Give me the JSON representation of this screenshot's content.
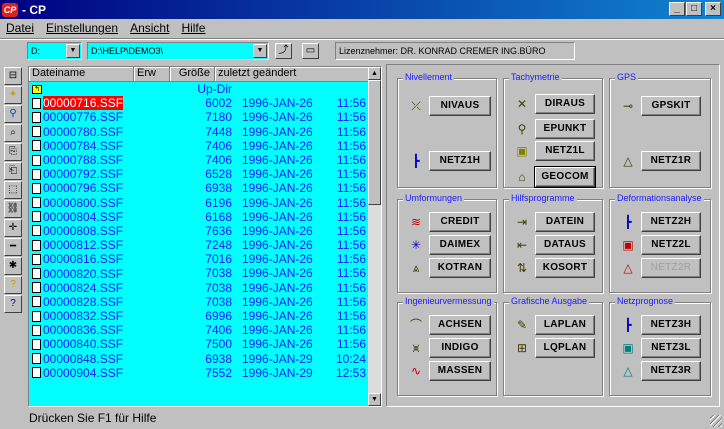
{
  "window": {
    "title": "- CP",
    "app_icon": "CP",
    "minimize": "_",
    "maximize": "□",
    "close": "×"
  },
  "menu": [
    "Datei",
    "Einstellungen",
    "Ansicht",
    "Hilfe"
  ],
  "toolbar": {
    "drive": "D:",
    "path": "D:\\HELP\\DEMO3\\",
    "license": "Lizenznehmer: DR. KONRAD CREMER ING.BÜRO"
  },
  "filelist": {
    "columns": [
      "Dateiname",
      "Erw",
      "Größe",
      "zuletzt geändert"
    ],
    "updir_label": "Up-Dir",
    "selected_index": 0,
    "rows": [
      {
        "name": "00000716.SSF",
        "size": "6002",
        "date": "1996-JAN-26",
        "time": "11:56"
      },
      {
        "name": "00000776.SSF",
        "size": "7180",
        "date": "1996-JAN-26",
        "time": "11:56"
      },
      {
        "name": "00000780.SSF",
        "size": "7448",
        "date": "1996-JAN-26",
        "time": "11:56"
      },
      {
        "name": "00000784.SSF",
        "size": "7406",
        "date": "1996-JAN-26",
        "time": "11:56"
      },
      {
        "name": "00000788.SSF",
        "size": "7406",
        "date": "1996-JAN-26",
        "time": "11:56"
      },
      {
        "name": "00000792.SSF",
        "size": "6528",
        "date": "1996-JAN-26",
        "time": "11:56"
      },
      {
        "name": "00000796.SSF",
        "size": "6938",
        "date": "1996-JAN-26",
        "time": "11:56"
      },
      {
        "name": "00000800.SSF",
        "size": "6196",
        "date": "1996-JAN-26",
        "time": "11:56"
      },
      {
        "name": "00000804.SSF",
        "size": "6168",
        "date": "1996-JAN-26",
        "time": "11:56"
      },
      {
        "name": "00000808.SSF",
        "size": "7636",
        "date": "1996-JAN-26",
        "time": "11:56"
      },
      {
        "name": "00000812.SSF",
        "size": "7248",
        "date": "1996-JAN-26",
        "time": "11:56"
      },
      {
        "name": "00000816.SSF",
        "size": "7016",
        "date": "1996-JAN-26",
        "time": "11:56"
      },
      {
        "name": "00000820.SSF",
        "size": "7038",
        "date": "1996-JAN-26",
        "time": "11:56"
      },
      {
        "name": "00000824.SSF",
        "size": "7038",
        "date": "1996-JAN-26",
        "time": "11:56"
      },
      {
        "name": "00000828.SSF",
        "size": "7038",
        "date": "1996-JAN-26",
        "time": "11:56"
      },
      {
        "name": "00000832.SSF",
        "size": "6996",
        "date": "1996-JAN-26",
        "time": "11:56"
      },
      {
        "name": "00000836.SSF",
        "size": "7406",
        "date": "1996-JAN-26",
        "time": "11:56"
      },
      {
        "name": "00000840.SSF",
        "size": "7500",
        "date": "1996-JAN-26",
        "time": "11:56"
      },
      {
        "name": "00000848.SSF",
        "size": "6938",
        "date": "1996-JAN-29",
        "time": "10:24"
      },
      {
        "name": "00000904.SSF",
        "size": "7552",
        "date": "1996-JAN-29",
        "time": "12:53"
      }
    ]
  },
  "status": "Drücken Sie F1 für Hilfe",
  "groups": [
    {
      "label": "Nivellement",
      "programs": [
        {
          "label": "NIVAUS",
          "icon": "level-icon",
          "glyph": "⤫"
        },
        {
          "label": "NETZ1H",
          "icon": "network-1h-icon",
          "glyph": "┣"
        }
      ]
    },
    {
      "label": "Tachymetrie",
      "programs": [
        {
          "label": "DIRAUS",
          "icon": "tachymeter-icon",
          "glyph": "✕"
        },
        {
          "label": "EPUNKT",
          "icon": "point-icon",
          "glyph": "⚲"
        },
        {
          "label": "NETZ1L",
          "icon": "cube-icon",
          "glyph": "▣"
        },
        {
          "label": "GEOCOM",
          "icon": "geocom-icon",
          "glyph": "⌂"
        }
      ]
    },
    {
      "label": "GPS",
      "programs": [
        {
          "label": "GPSKIT",
          "icon": "satellite-icon",
          "glyph": "⊸"
        },
        {
          "label": "NETZ1R",
          "icon": "triangle-icon",
          "glyph": "△"
        }
      ]
    },
    {
      "label": "Umformungen",
      "programs": [
        {
          "label": "CREDIT",
          "icon": "credit-icon",
          "glyph": "≋"
        },
        {
          "label": "DAIMEX",
          "icon": "star-icon",
          "glyph": "✳"
        },
        {
          "label": "KOTRAN",
          "icon": "transform-icon",
          "glyph": "⩓"
        }
      ]
    },
    {
      "label": "Hilfsprogramme",
      "programs": [
        {
          "label": "DATEIN",
          "icon": "file-in-icon",
          "glyph": "⇥"
        },
        {
          "label": "DATAUS",
          "icon": "file-out-icon",
          "glyph": "⇤"
        },
        {
          "label": "KOSORT",
          "icon": "sort-icon",
          "glyph": "⇅"
        }
      ]
    },
    {
      "label": "Deformationsanalyse",
      "programs": [
        {
          "label": "NETZ2H",
          "icon": "network-2h-icon",
          "glyph": "┣"
        },
        {
          "label": "NETZ2L",
          "icon": "cube-red-icon",
          "glyph": "▣"
        },
        {
          "label": "NETZ2R",
          "icon": "triangle-red-icon",
          "glyph": "△"
        }
      ]
    },
    {
      "label": "Ingenieurvermessung",
      "programs": [
        {
          "label": "ACHSEN",
          "icon": "axis-icon",
          "glyph": "⌒"
        },
        {
          "label": "INDIGO",
          "icon": "indigo-icon",
          "glyph": "⩙"
        },
        {
          "label": "MASSEN",
          "icon": "mass-icon",
          "glyph": "∿"
        }
      ]
    },
    {
      "label": "Grafische Ausgabe",
      "programs": [
        {
          "label": "LAPLAN",
          "icon": "pen-icon",
          "glyph": "✎"
        },
        {
          "label": "LQPLAN",
          "icon": "plot-icon",
          "glyph": "⊞"
        }
      ]
    },
    {
      "label": "Netzprognose",
      "programs": [
        {
          "label": "NETZ3H",
          "icon": "network-3h-icon",
          "glyph": "┣"
        },
        {
          "label": "NETZ3L",
          "icon": "cube-green-icon",
          "glyph": "▣"
        },
        {
          "label": "NETZ3R",
          "icon": "triangle-green-icon",
          "glyph": "△"
        }
      ]
    }
  ],
  "toolbar_icons": {
    "up": "⤴",
    "folder": "▭",
    "drive_glyph": "▬"
  },
  "left_tools": [
    "⊟",
    "✦",
    "⚲",
    "⌕",
    "⎘",
    "⎗",
    "⬚",
    "⛓",
    "✛",
    "━",
    "✱",
    "?",
    "?"
  ]
}
